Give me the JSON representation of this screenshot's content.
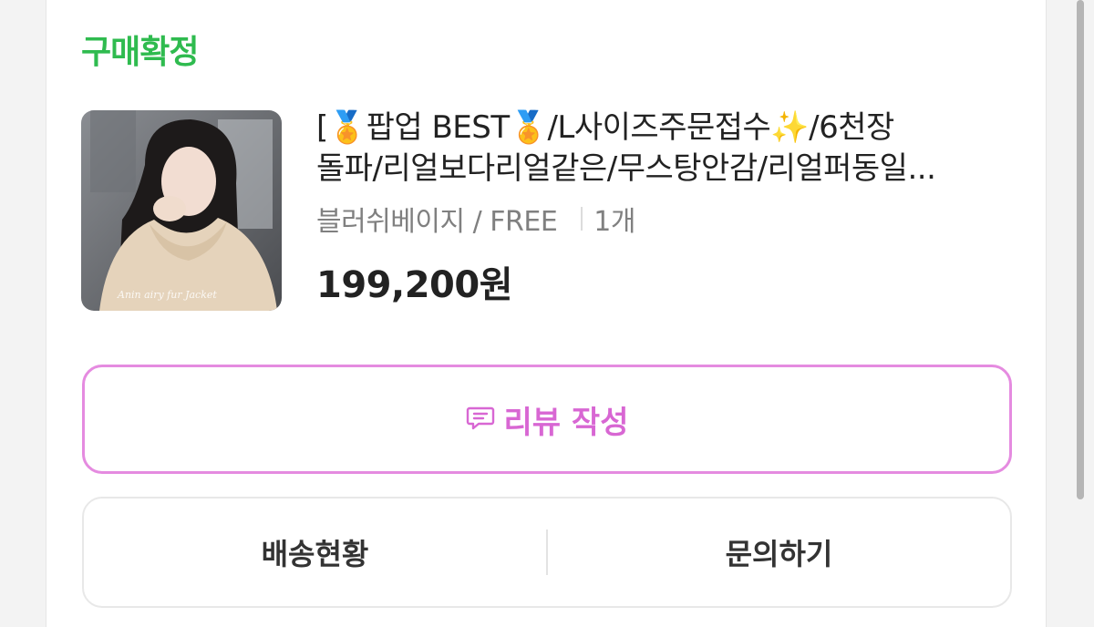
{
  "order": {
    "status": "구매확정",
    "status_color": "#2fbb4f"
  },
  "product": {
    "title_line1": "[🏅팝업 BEST🏅/L사이즈주문접수✨/6천장",
    "title_line2": "돌파/리얼보다리얼같은/무스탕안감/리얼퍼동일...",
    "option": "블러쉬베이지 / FREE",
    "quantity": "1개",
    "price": "199,200원",
    "thumbnail_caption": "Anin airy fur Jacket"
  },
  "actions": {
    "review_label": "리뷰 작성",
    "review_color": "#d867d3",
    "delivery_label": "배송현황",
    "inquiry_label": "문의하기"
  },
  "icons": {
    "review": "chat-bubble-icon"
  }
}
